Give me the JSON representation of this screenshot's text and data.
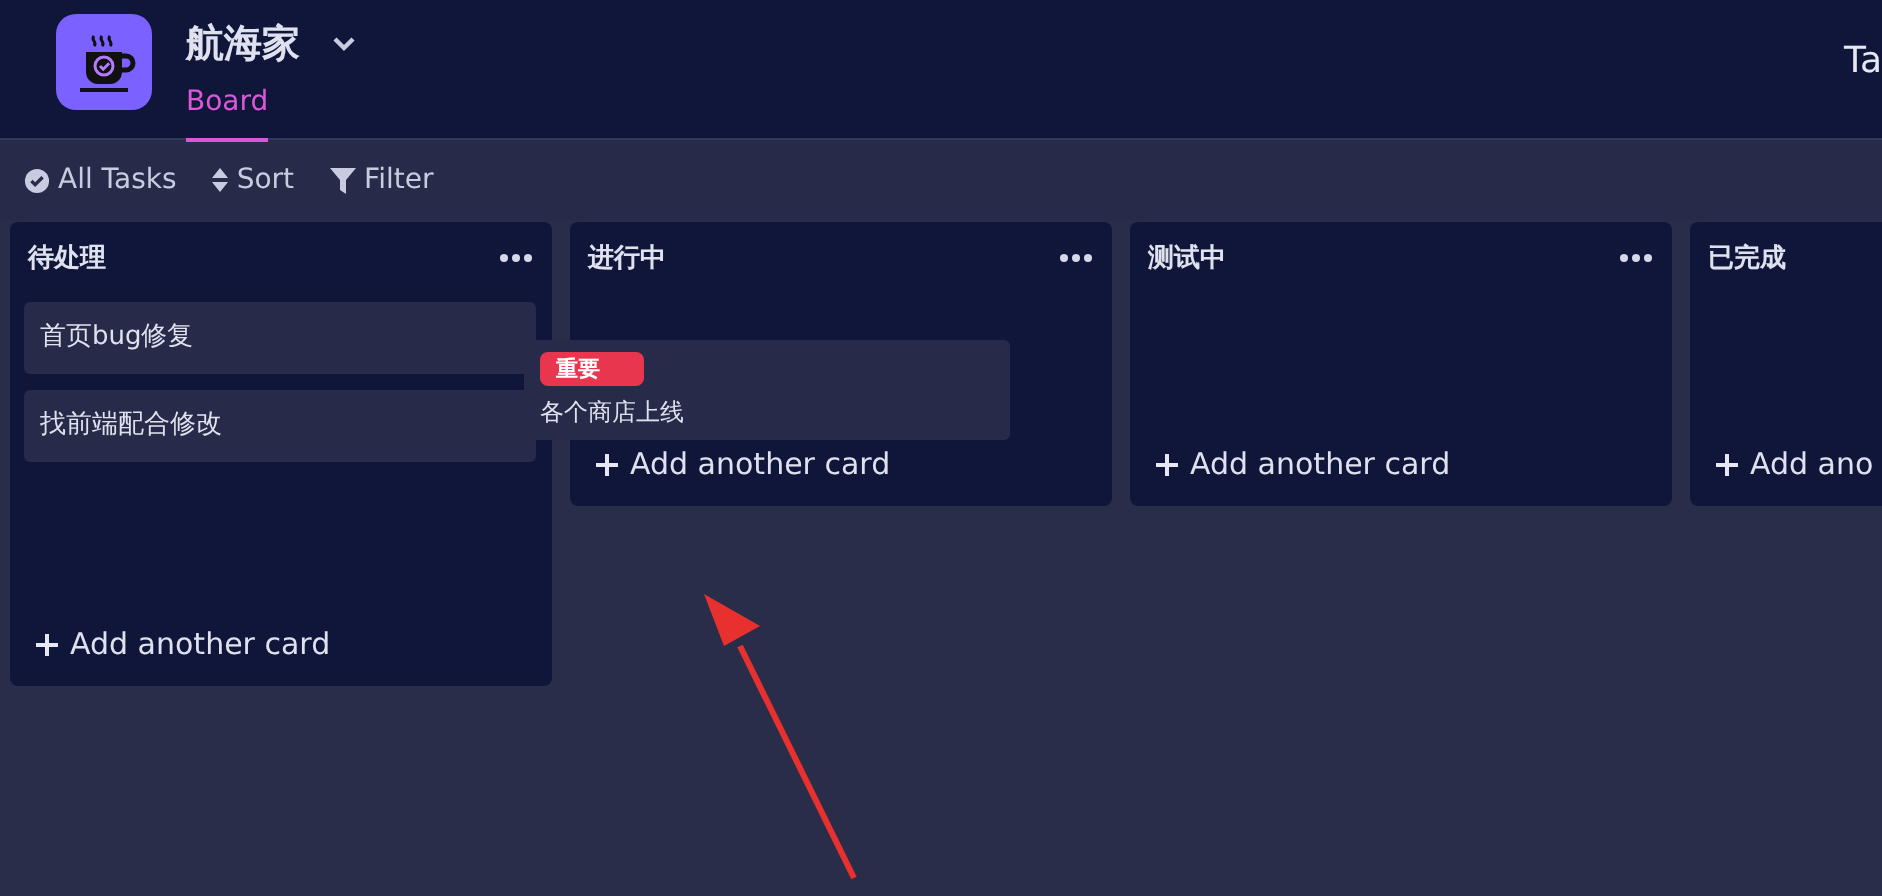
{
  "app": {
    "name": "航海家",
    "tabs": [
      {
        "label": "Board",
        "selected": true
      }
    ],
    "right_text": "Ta"
  },
  "toolbar": [
    {
      "kind": "check",
      "label": "All Tasks"
    },
    {
      "kind": "sort",
      "label": "Sort"
    },
    {
      "kind": "filter",
      "label": "Filter"
    }
  ],
  "columns": [
    {
      "title": "待处理",
      "has_menu": true,
      "cards": [
        {
          "title": "首页bug修复"
        },
        {
          "title": "找前端配合修改"
        }
      ],
      "add_label": "Add another card"
    },
    {
      "title": "进行中",
      "has_menu": true,
      "add_label": "Add another card"
    },
    {
      "title": "测试中",
      "has_menu": true,
      "add_label": "Add another card"
    },
    {
      "title": "已完成",
      "has_menu": false,
      "add_label": "Add ano"
    }
  ],
  "dragged_card": {
    "tag": "重要",
    "title": "各个商店上线"
  }
}
